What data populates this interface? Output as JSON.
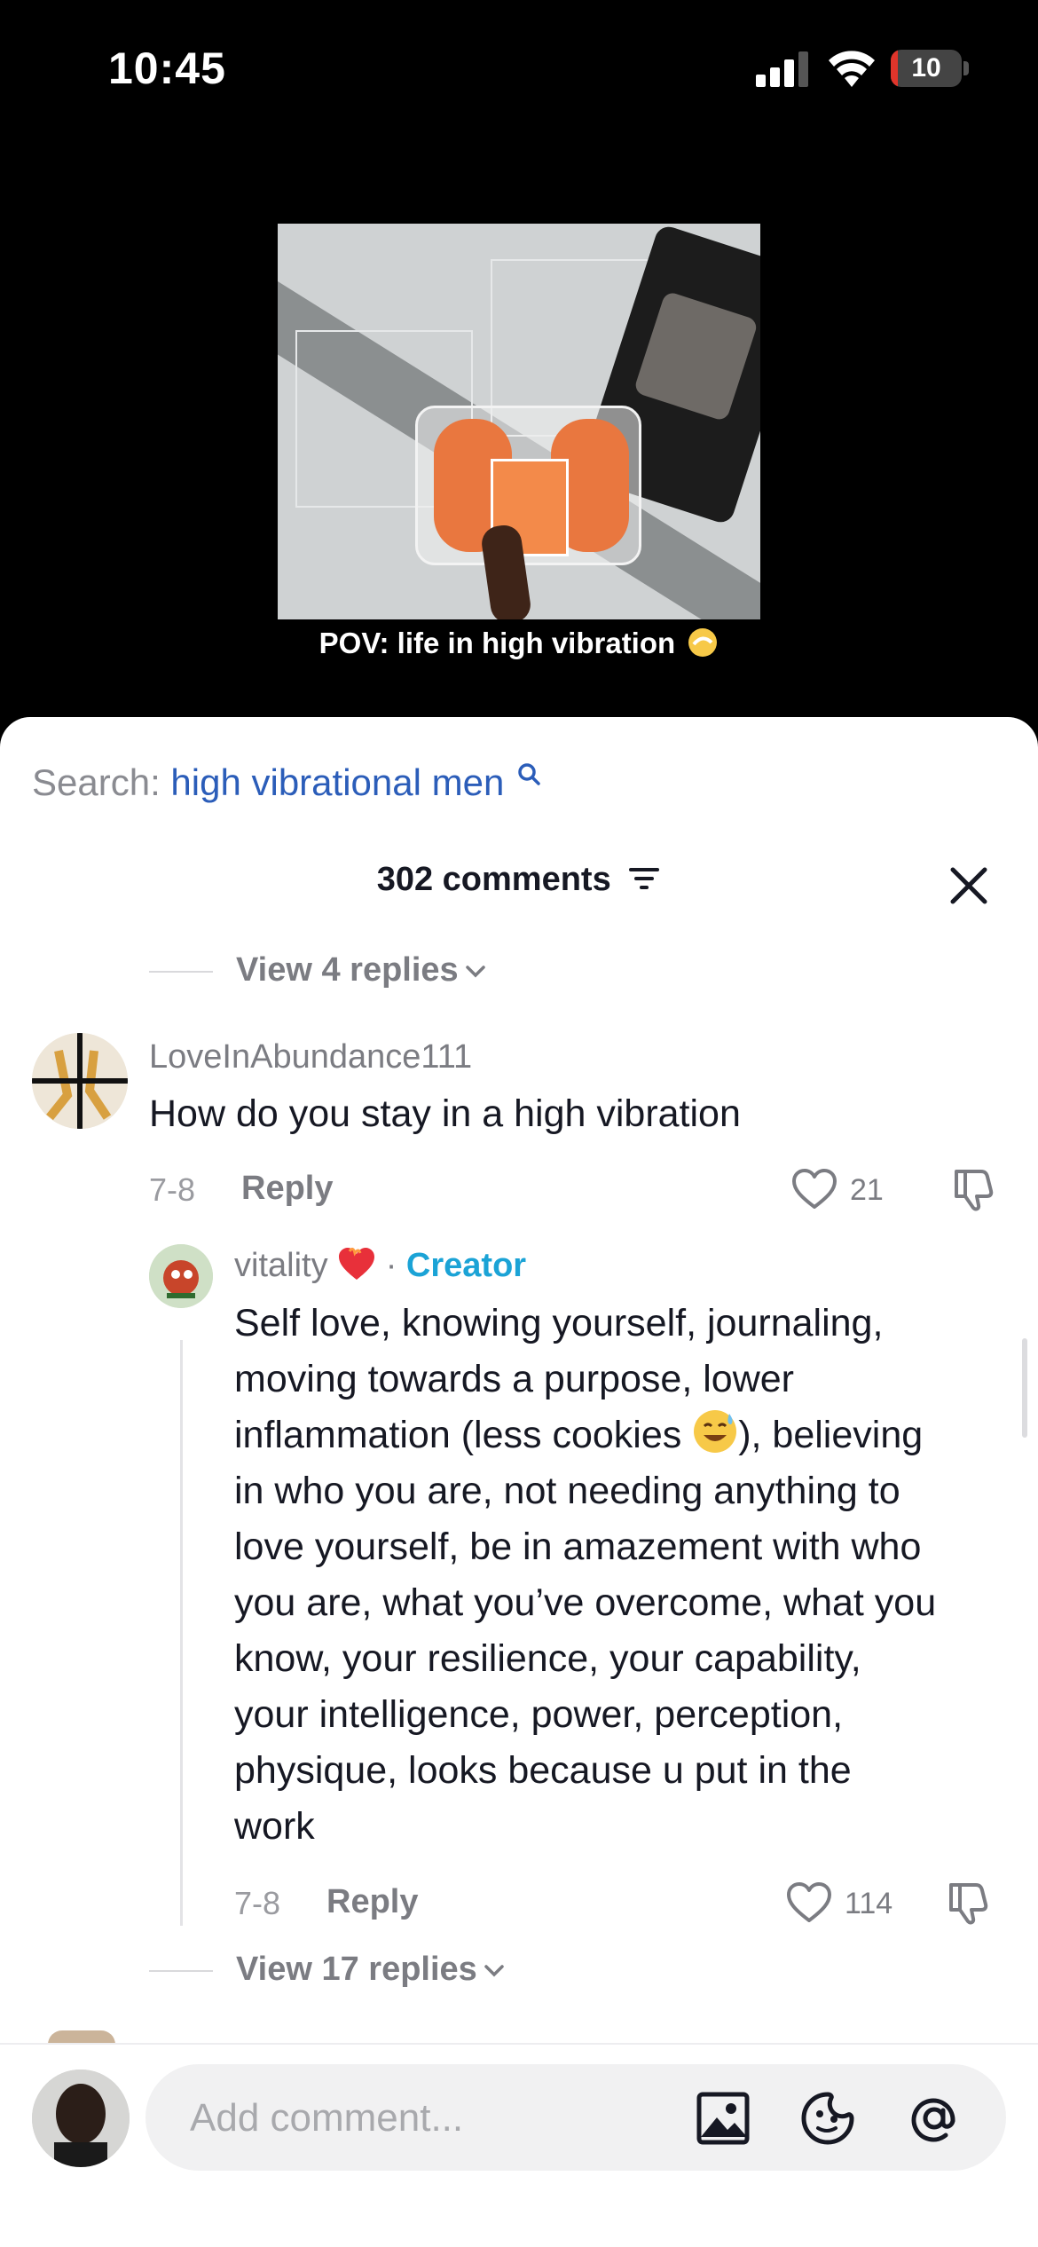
{
  "status_bar": {
    "time": "10:45",
    "battery_level": "10",
    "battery_color": "#e0352b"
  },
  "video": {
    "caption": "POV: life in high vibration",
    "caption_emoji_icon": "dizzy-star-icon"
  },
  "search": {
    "label": "Search:",
    "term": "high vibrational men",
    "term_color": "#2b5db9"
  },
  "comments_header": {
    "count_label": "302 comments"
  },
  "replies_top": {
    "label": "View 4 replies"
  },
  "comment_main": {
    "username": "LoveInAbundance111",
    "text": "How do you stay in a high vibration",
    "date": "7-8",
    "reply_label": "Reply",
    "likes": "21"
  },
  "comment_reply": {
    "username": "vitality",
    "separator": "·",
    "creator_label": "Creator",
    "creator_color": "#1ba3d6",
    "lines": [
      "Self love, knowing yourself, journaling,",
      "moving towards a purpose, lower",
      "inflammation (less cookies",
      "), believing",
      "in who you are, not needing anything to",
      "love yourself, be in amazement with who",
      "you are, what you’ve overcome, what you",
      "know, your resilience, your capability,",
      "your intelligence, power, perception,",
      "physique, looks because u put in the",
      "work"
    ],
    "date": "7-8",
    "reply_label": "Reply",
    "likes": "114"
  },
  "replies_bottom": {
    "label": "View 17 replies"
  },
  "comment_input": {
    "placeholder": "Add comment..."
  }
}
